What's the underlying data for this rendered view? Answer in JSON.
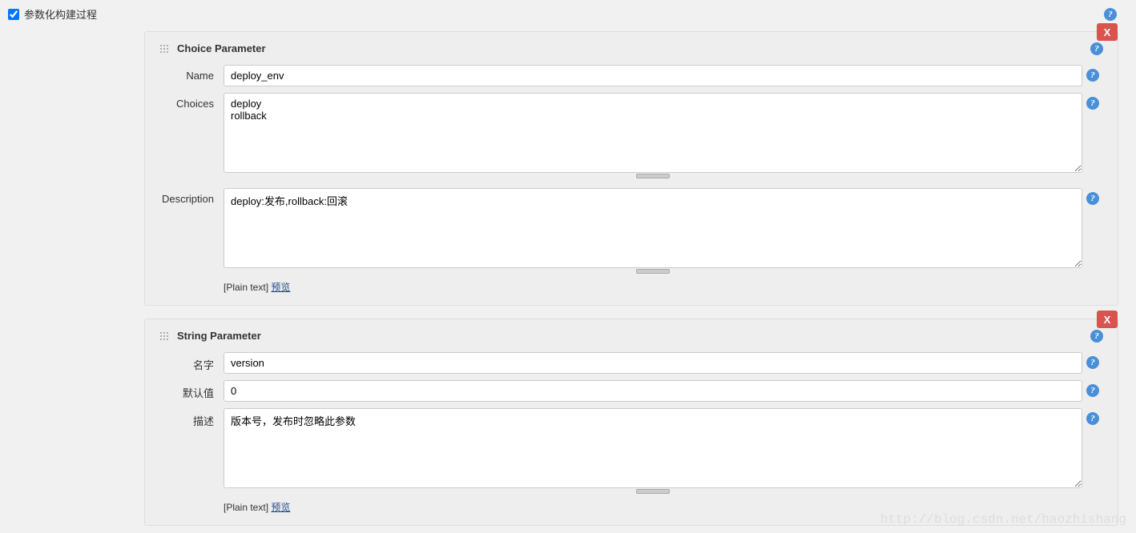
{
  "top": {
    "checkbox_label": "参数化构建过程",
    "checked": true
  },
  "panels": [
    {
      "delete": "X",
      "title": "Choice Parameter",
      "fields": {
        "name": {
          "label": "Name",
          "value": "deploy_env"
        },
        "choices": {
          "label": "Choices",
          "value": "deploy\nrollback"
        },
        "description": {
          "label": "Description",
          "value": "deploy:发布,rollback:回滚"
        }
      },
      "below": {
        "plain": "[Plain text] ",
        "preview": "预览"
      }
    },
    {
      "delete": "X",
      "title": "String Parameter",
      "fields": {
        "name": {
          "label": "名字",
          "value": "version"
        },
        "default": {
          "label": "默认值",
          "value": "0"
        },
        "description": {
          "label": "描述",
          "value": "版本号，发布时忽略此参数"
        }
      },
      "below": {
        "plain": "[Plain text] ",
        "preview": "预览"
      }
    }
  ],
  "watermark": "http://blog.csdn.net/haozhishang"
}
